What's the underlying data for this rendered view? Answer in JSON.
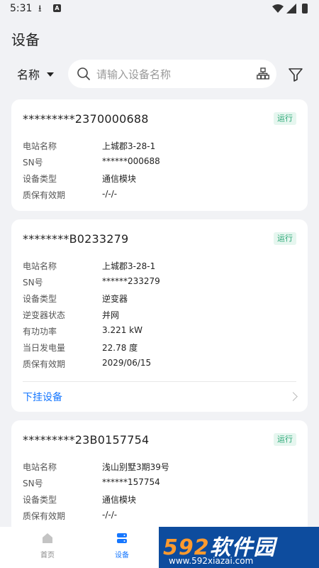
{
  "statusbar": {
    "time": "5:31"
  },
  "header": {
    "title": "设备"
  },
  "search": {
    "sort_label": "名称",
    "placeholder": "请输入设备名称"
  },
  "devices": [
    {
      "id": "*********2370000688",
      "status": "运行",
      "rows": [
        {
          "k": "电站名称",
          "v": "上城郡3-28-1"
        },
        {
          "k": "SN号",
          "v": "******000688"
        },
        {
          "k": "设备类型",
          "v": "通信模块"
        },
        {
          "k": "质保有效期",
          "v": "-/-/-"
        }
      ]
    },
    {
      "id": "********B0233279",
      "status": "运行",
      "rows": [
        {
          "k": "电站名称",
          "v": "上城郡3-28-1"
        },
        {
          "k": "SN号",
          "v": "******233279"
        },
        {
          "k": "设备类型",
          "v": "逆变器"
        },
        {
          "k": "逆变器状态",
          "v": "并网"
        },
        {
          "k": "有功功率",
          "v": "3.221 kW"
        },
        {
          "k": "当日发电量",
          "v": "22.78 度"
        },
        {
          "k": "质保有效期",
          "v": "2029/06/15"
        }
      ],
      "sub_link": "下挂设备"
    },
    {
      "id": "*********23B0157754",
      "status": "运行",
      "rows": [
        {
          "k": "电站名称",
          "v": "浅山别墅3期39号"
        },
        {
          "k": "SN号",
          "v": "******157754"
        },
        {
          "k": "设备类型",
          "v": "通信模块"
        },
        {
          "k": "质保有效期",
          "v": "-/-/-"
        }
      ]
    }
  ],
  "tabbar": {
    "tabs": [
      {
        "label": "首页",
        "icon": "home-icon"
      },
      {
        "label": "设备",
        "icon": "device-icon",
        "active": true
      }
    ]
  },
  "watermark": {
    "main_a": "592",
    "main_b": "软件园",
    "url": "www.592xiazai.com"
  },
  "colors": {
    "accent": "#1677ff",
    "status_green": "#2aa876",
    "background": "#f1f2f5"
  }
}
